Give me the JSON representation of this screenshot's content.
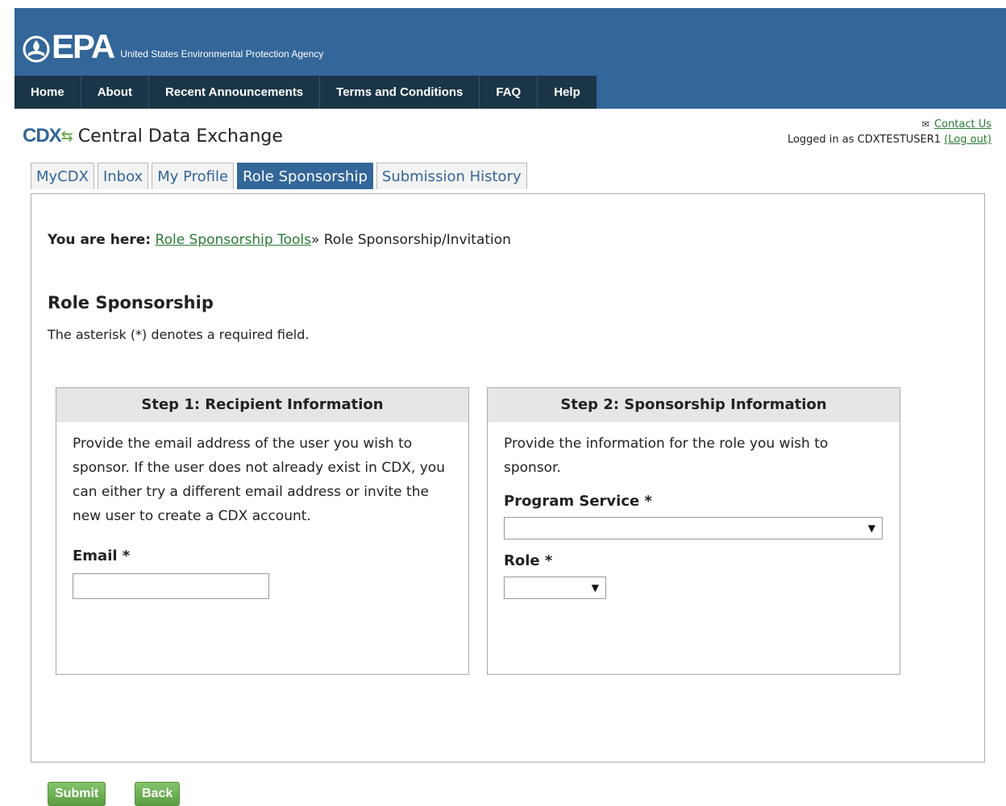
{
  "header": {
    "logo_text": "EPA",
    "agency_name": "United States Environmental Protection Agency"
  },
  "nav": {
    "items": [
      "Home",
      "About",
      "Recent Announcements",
      "Terms and Conditions",
      "FAQ",
      "Help"
    ]
  },
  "cdx": {
    "logo": "CDX",
    "title": "Central Data Exchange"
  },
  "account": {
    "contact_label": "Contact Us",
    "logged_in_prefix": "Logged in as CDXTESTUSER1",
    "logout_label": "(Log out)"
  },
  "tabs": [
    {
      "label": "MyCDX",
      "active": false
    },
    {
      "label": "Inbox",
      "active": false
    },
    {
      "label": "My Profile",
      "active": false
    },
    {
      "label": "Role Sponsorship",
      "active": true
    },
    {
      "label": "Submission History",
      "active": false
    }
  ],
  "breadcrumb": {
    "prefix": "You are here:",
    "link": "Role Sponsorship Tools",
    "separator": "»",
    "current": "Role Sponsorship/Invitation"
  },
  "page": {
    "title": "Role Sponsorship",
    "required_note": "The asterisk (*) denotes a required field."
  },
  "step1": {
    "heading": "Step 1: Recipient Information",
    "description": "Provide the email address of the user you wish to sponsor. If the user does not already exist in CDX, you can either try a different email address or invite the new user to create a CDX account.",
    "email_label": "Email *",
    "email_value": ""
  },
  "step2": {
    "heading": "Step 2: Sponsorship Information",
    "description": "Provide the information for the role you wish to sponsor.",
    "program_service_label": "Program Service *",
    "program_service_value": "",
    "role_label": "Role *",
    "role_value": ""
  },
  "actions": {
    "submit_label": "Submit",
    "back_label": "Back"
  },
  "colors": {
    "header_blue": "#336699",
    "nav_dark": "#1a3547",
    "link_green": "#2a7a35",
    "button_green": "#5c9c42"
  }
}
